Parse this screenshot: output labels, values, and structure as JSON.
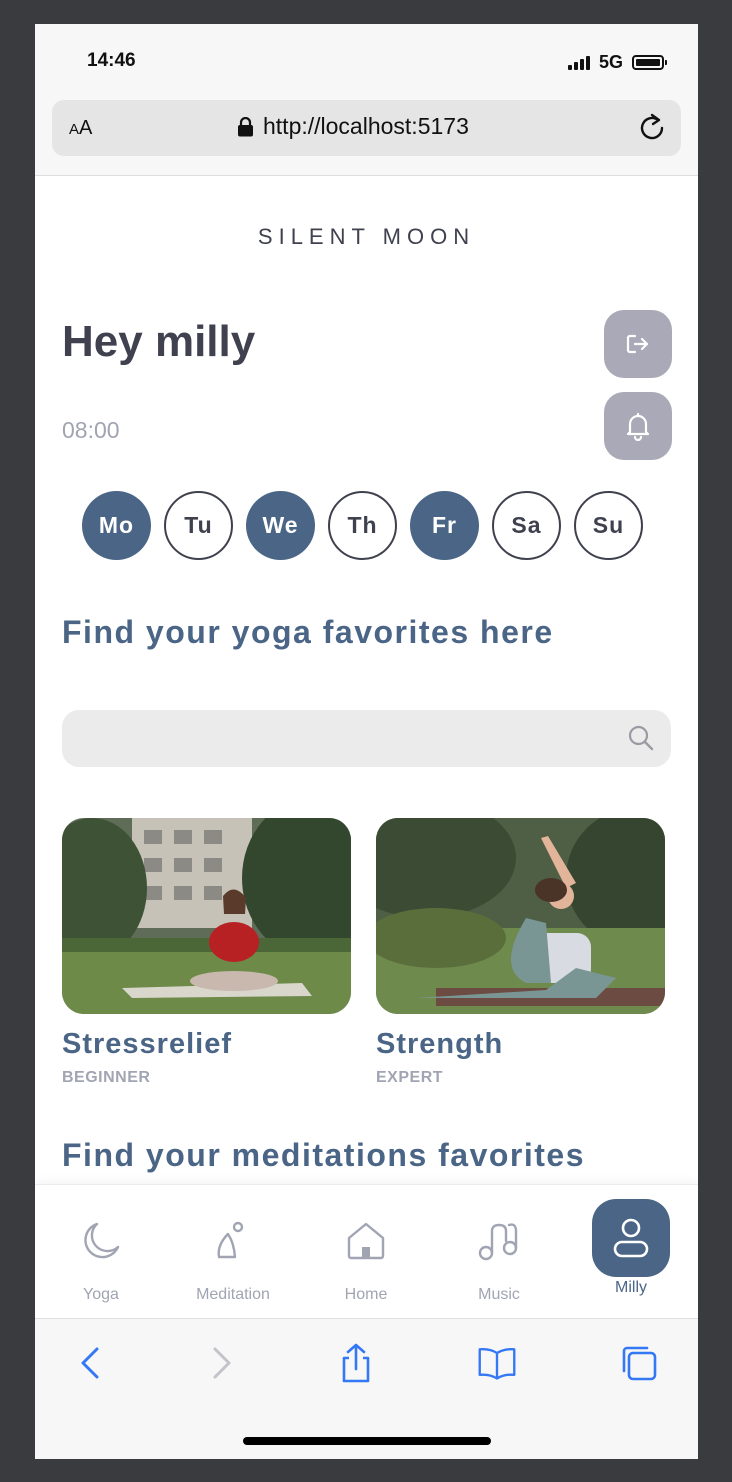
{
  "status": {
    "time": "14:46",
    "network": "5G"
  },
  "browser": {
    "text_size_small": "A",
    "text_size_big": "A",
    "url": "http://localhost:5173"
  },
  "brand": "SILENT  MOON",
  "greeting": "Hey milly",
  "reminder_time": "08:00",
  "days": [
    {
      "label": "Mo",
      "selected": true
    },
    {
      "label": "Tu",
      "selected": false
    },
    {
      "label": "We",
      "selected": true
    },
    {
      "label": "Th",
      "selected": false
    },
    {
      "label": "Fr",
      "selected": true
    },
    {
      "label": "Sa",
      "selected": false
    },
    {
      "label": "Su",
      "selected": false
    }
  ],
  "sections": {
    "yoga_title": "Find your yoga favorites here",
    "meditation_title": "Find your meditations favorites"
  },
  "search": {
    "placeholder": ""
  },
  "cards": [
    {
      "title": "Stressrelief",
      "level": "BEGINNER"
    },
    {
      "title": "Strength",
      "level": "EXPERT"
    }
  ],
  "tabs": [
    {
      "label": "Yoga",
      "icon": "moon-icon"
    },
    {
      "label": "Meditation",
      "icon": "meditation-icon"
    },
    {
      "label": "Home",
      "icon": "home-icon"
    },
    {
      "label": "Music",
      "icon": "music-icon"
    },
    {
      "label": "Milly",
      "icon": "profile-icon",
      "active": true
    }
  ],
  "colors": {
    "primary": "#4a6586",
    "dark": "#3f414e",
    "muted": "#a1a4b2",
    "button_grey": "#a9a9b7",
    "ios_blue": "#3478f6"
  }
}
